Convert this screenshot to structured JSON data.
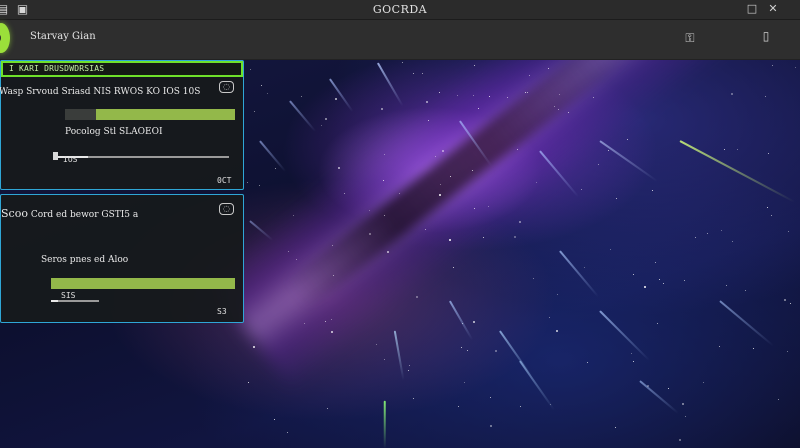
{
  "window": {
    "title": "GOCRDA",
    "left_icons": [
      "folder-icon",
      "save-icon"
    ],
    "right_icons": [
      "minimize-icon",
      "close-icon"
    ]
  },
  "toolbar": {
    "title": "Starvay Gian",
    "icons": [
      "key-icon",
      "bookmark-icon"
    ]
  },
  "panel1": {
    "header_label": "I KARI DRUSDWDRSIAS",
    "status_line": "Wasp Srvoud Sriasd NIS RWOS KO IOS 10S",
    "bar_label": "Pocolog Stl SLAOEOI",
    "bar_fill": 0.82,
    "slider_label": "IOS",
    "slider_level": 0.2,
    "corner_value": "0CT",
    "accent": "#6fe22a",
    "border": "#2fa6d6"
  },
  "panel2": {
    "title_prefix": "Scoo",
    "title": "Cord ed bewor GSTI5 a",
    "subtitle": "Seros pnes ed Aloo",
    "bar_fill": 1.0,
    "slider_label": "SIS",
    "slider_level": 0.15,
    "corner_value": "S3",
    "bar_color": "#93b84a"
  }
}
